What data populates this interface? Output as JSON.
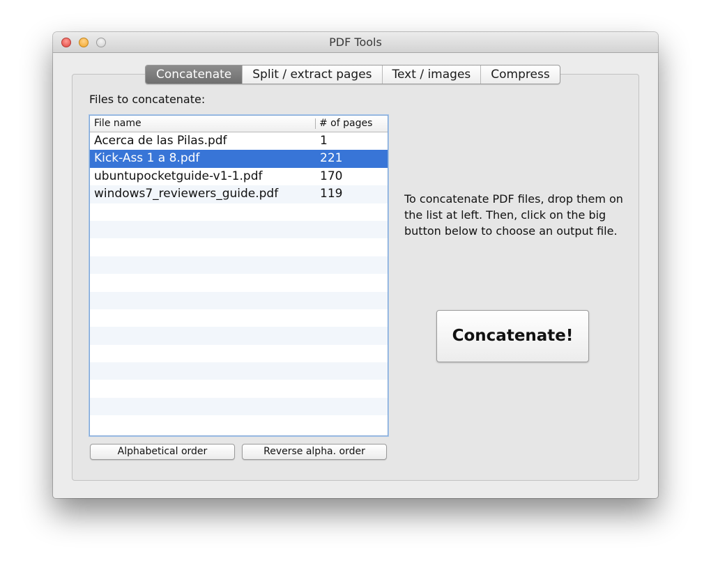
{
  "window": {
    "title": "PDF Tools"
  },
  "tabs": [
    {
      "label": "Concatenate",
      "selected": true
    },
    {
      "label": "Split / extract pages",
      "selected": false
    },
    {
      "label": "Text / images",
      "selected": false
    },
    {
      "label": "Compress",
      "selected": false
    }
  ],
  "files_section": {
    "label": "Files to concatenate:",
    "columns": {
      "name": "File name",
      "pages": "# of pages"
    },
    "rows": [
      {
        "name": "Acerca de las Pilas.pdf",
        "pages": "1"
      },
      {
        "name": "Kick-Ass 1 a 8.pdf",
        "pages": "221"
      },
      {
        "name": "ubuntupocketguide-v1-1.pdf",
        "pages": "170"
      },
      {
        "name": "windows7_reviewers_guide.pdf",
        "pages": "119"
      }
    ],
    "selected_row": 1
  },
  "instructions": "To concatenate PDF files, drop them on the list at left. Then, click on the big button below to choose an output file.",
  "actions": {
    "concatenate_label": "Concatenate!",
    "alpha_order_label": "Alphabetical order",
    "reverse_order_label": "Reverse alpha. order"
  },
  "colors": {
    "selection": "#3875d7",
    "stripe": "#f2f6fb",
    "window_bg": "#ececec"
  }
}
